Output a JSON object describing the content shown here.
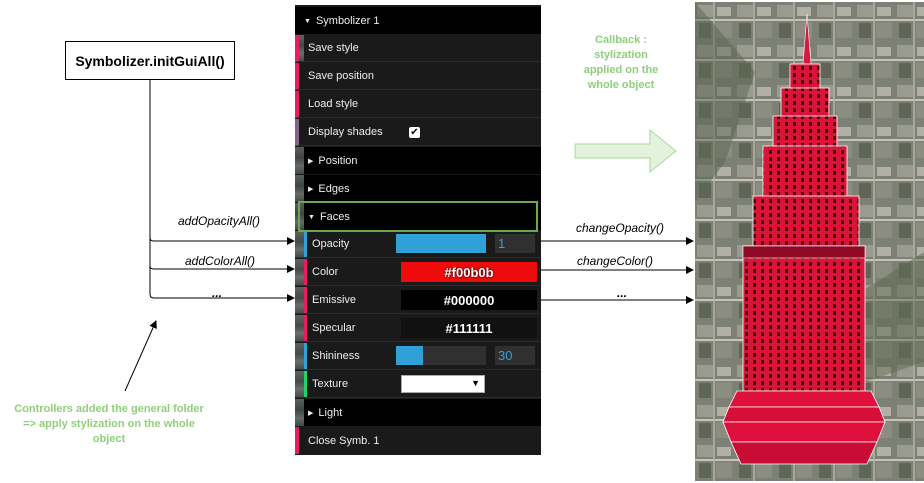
{
  "left": {
    "function_box": "Symbolizer.initGuiAll()",
    "calls": [
      "addOpacityAll()",
      "addColorAll()",
      "..."
    ],
    "note": "Controllers added the general folder\n=> apply stylization on the whole\nobject"
  },
  "gui": {
    "header": "Symbolizer 1",
    "save_style": "Save style",
    "save_position": "Save position",
    "load_style": "Load style",
    "display_shades": "Display shades",
    "display_shades_checked": true,
    "position_folder": "Position",
    "edges_folder": "Edges",
    "faces_folder": "Faces",
    "opacity_label": "Opacity",
    "opacity_value": "1",
    "opacity_fraction": 1.0,
    "color_label": "Color",
    "color_value": "#f00b0b",
    "emissive_label": "Emissive",
    "emissive_value": "#000000",
    "specular_label": "Specular",
    "specular_value": "#111111",
    "shininess_label": "Shininess",
    "shininess_value": "30",
    "shininess_fraction": 0.3,
    "texture_label": "Texture",
    "texture_value": "",
    "light_folder": "Light",
    "close": "Close Symb. 1"
  },
  "right": {
    "callbacks": [
      "changeOpacity()",
      "changeColor()",
      "..."
    ],
    "note": "Callback :\nstylization\napplied on the\nwhole object"
  },
  "colors": {
    "accent_green": "#8fcf7b",
    "building_red": "#e0103c",
    "slider_blue": "#2fa1d6"
  }
}
